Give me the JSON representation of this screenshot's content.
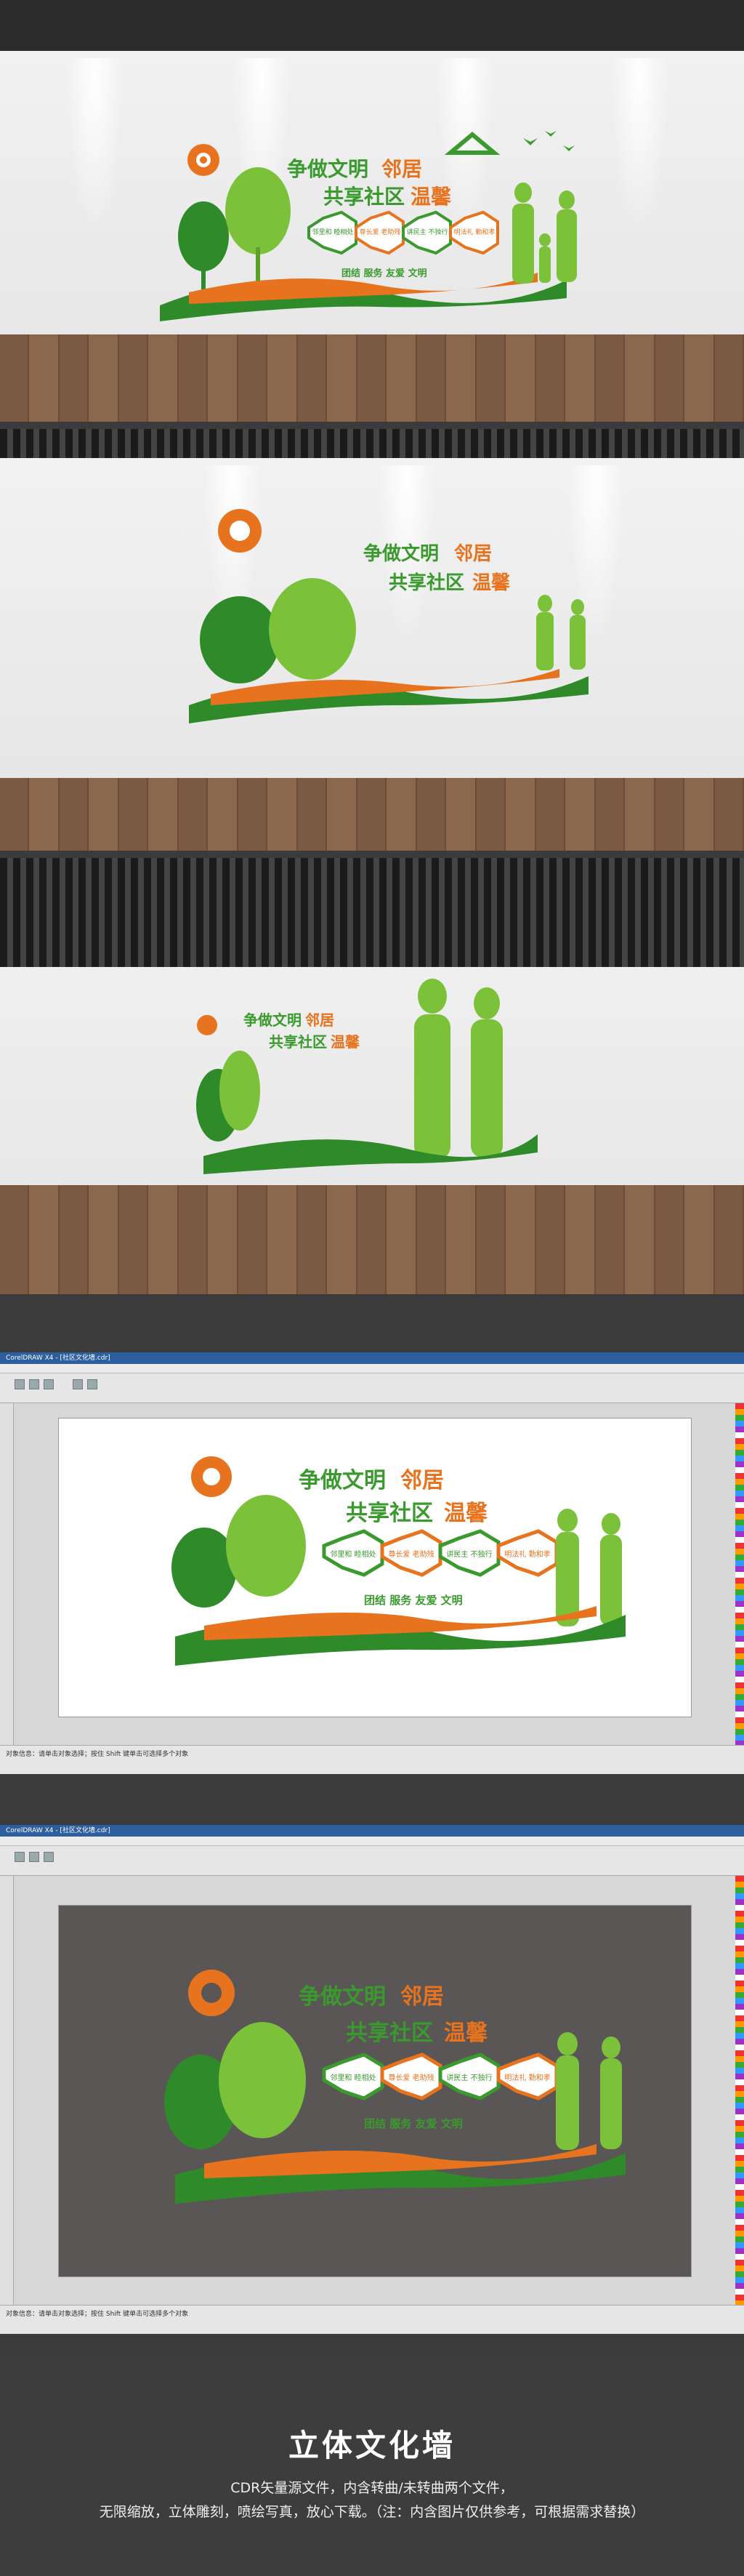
{
  "mockup": {
    "slogan_line1_a": "争做文明",
    "slogan_line1_b": "邻居",
    "slogan_line2_a": "共享社区",
    "slogan_line2_b": "温馨",
    "hex1": "邻里和 睦相处",
    "hex2": "尊长爱 老助残",
    "hex3": "讲民主 不独行",
    "hex4": "明法礼 勤和孝",
    "values": "团结 服务 友爱 文明"
  },
  "software": {
    "title": "CorelDRAW X4 - [社区文化墙.cdr]",
    "status": "对象信息：请单击对象选择；按住 Shift 键单击可选择多个对象"
  },
  "footer": {
    "title": "立体文化墙",
    "line1": "CDR矢量源文件，内含转曲/未转曲两个文件，",
    "line2": "无限缩放，立体雕刻，喷绘写真，放心下载。（注：内含图片仅供参考，可根据需求替换）"
  },
  "colors": {
    "green": "#3a9a2e",
    "light_green": "#7cc13a",
    "orange": "#e8731e",
    "gray_bg": "#5a5656"
  }
}
